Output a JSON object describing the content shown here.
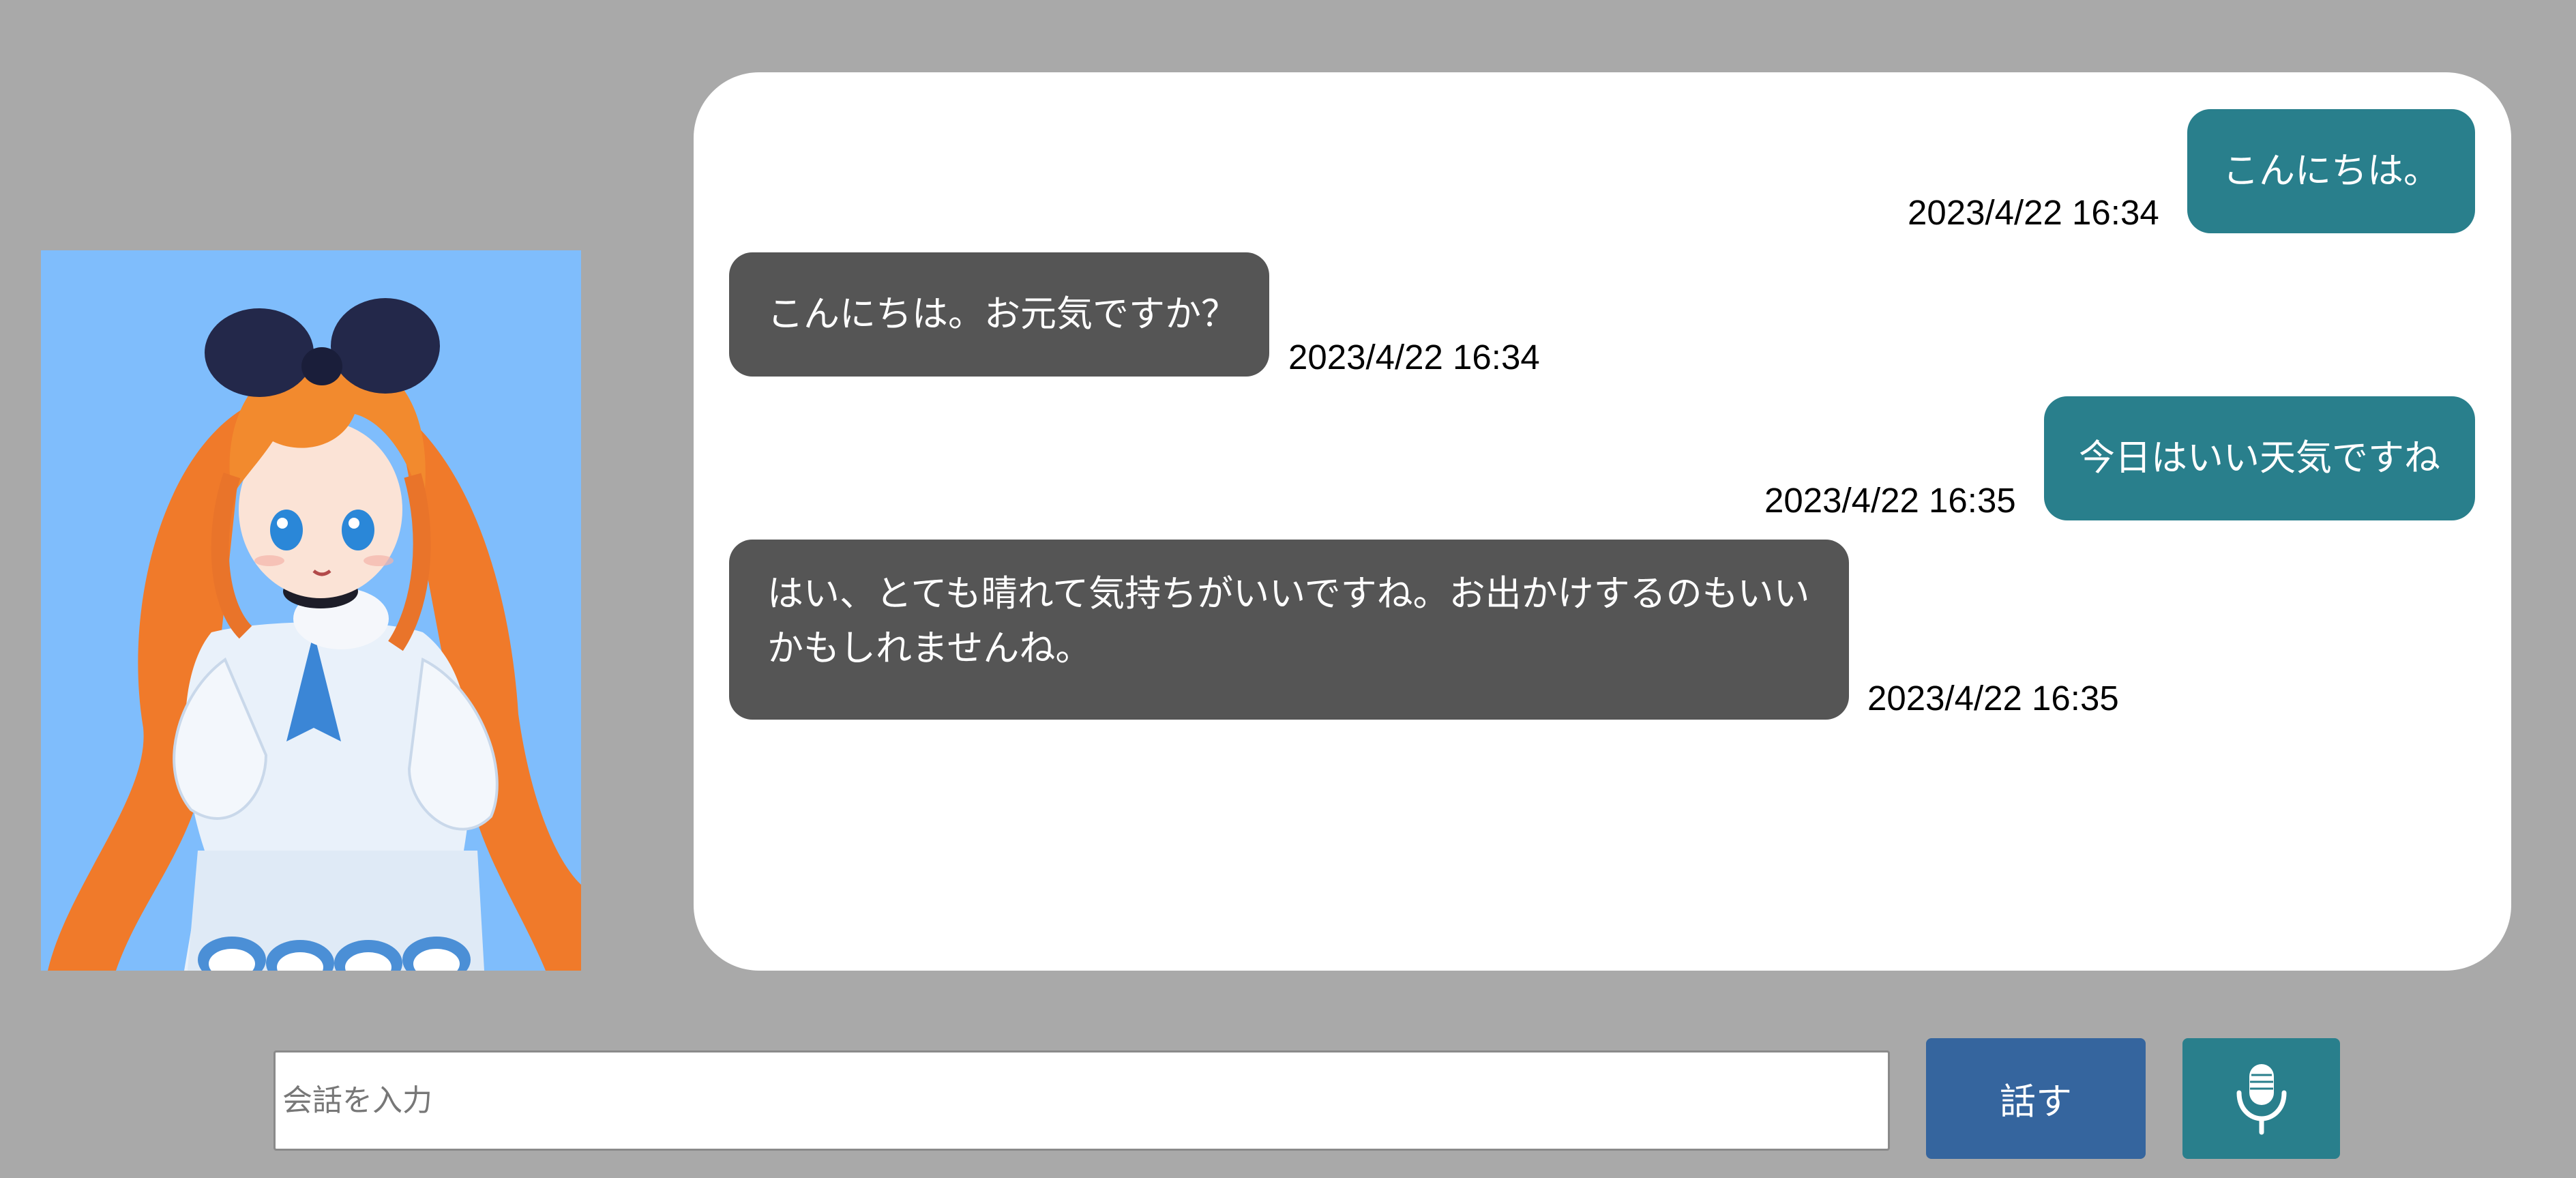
{
  "colors": {
    "page_background": "#a9a9a9",
    "avatar_background": "#7fbdfc",
    "user_bubble": "#297f8c",
    "bot_bubble": "#555555",
    "speak_button": "#35659e",
    "mic_button": "#297f8c"
  },
  "avatar": {
    "description_icon": "anime-girl-character-icon"
  },
  "messages": [
    {
      "sender": "user",
      "text": "こんにちは。",
      "timestamp": "2023/4/22 16:34"
    },
    {
      "sender": "bot",
      "text": "こんにちは。お元気ですか？",
      "timestamp": "2023/4/22 16:34"
    },
    {
      "sender": "user",
      "text": "今日はいい天気ですね",
      "timestamp": "2023/4/22 16:35"
    },
    {
      "sender": "bot",
      "text": "はい、とても晴れて気持ちがいいですね。お出かけするのもいいかもしれませんね。",
      "timestamp": "2023/4/22 16:35"
    }
  ],
  "input": {
    "placeholder": "会話を入力",
    "value": ""
  },
  "buttons": {
    "speak_label": "話す",
    "mic_icon": "microphone-icon"
  }
}
